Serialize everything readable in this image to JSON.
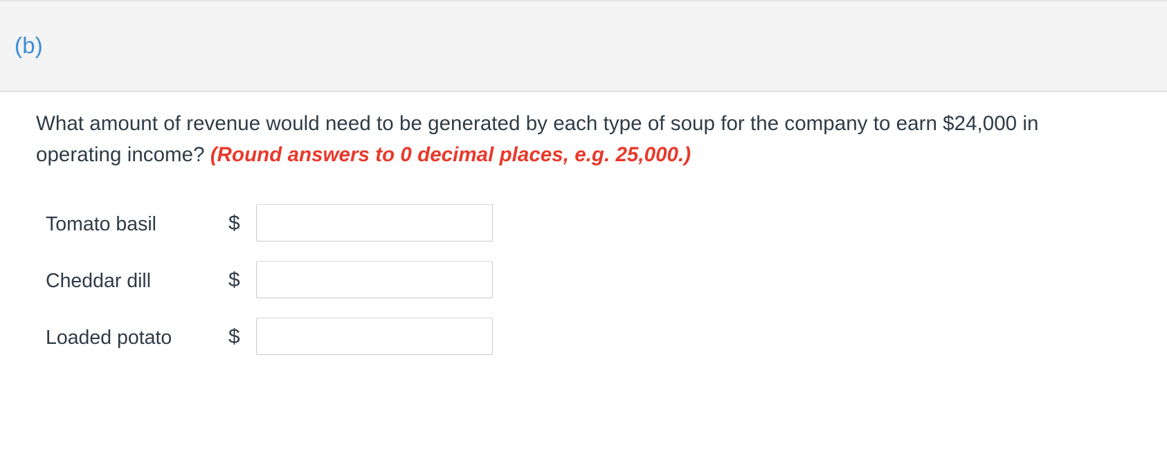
{
  "header": {
    "part_label": "(b)",
    "accent_color": "#3c8dd4",
    "background_color": "#f4f4f4"
  },
  "question": {
    "prompt_before": "What amount of revenue would need to be generated by each type of soup for the company to earn $24,000 in operating income? ",
    "instruction": "(Round answers to 0 decimal places, e.g. 25,000.)",
    "instruction_color": "#e8392b",
    "text_color": "#2f3b46"
  },
  "answers": {
    "currency_symbol": "$",
    "rows": [
      {
        "label": "Tomato basil",
        "value": "",
        "placeholder": ""
      },
      {
        "label": "Cheddar dill",
        "value": "",
        "placeholder": ""
      },
      {
        "label": "Loaded potato",
        "value": "",
        "placeholder": ""
      }
    ]
  }
}
